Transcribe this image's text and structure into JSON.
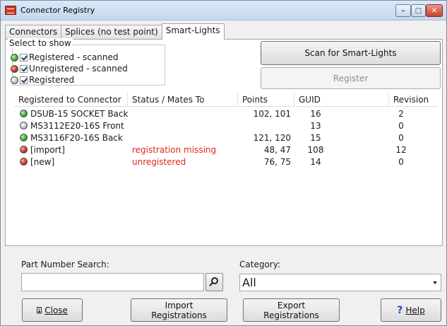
{
  "window": {
    "title": "Connector Registry",
    "controls": {
      "minimize": "–",
      "maximize": "□",
      "close": "✕"
    }
  },
  "tabs": [
    {
      "label": "Connectors",
      "active": false
    },
    {
      "label": "Splices (no test point)",
      "active": false
    },
    {
      "label": "Smart-Lights",
      "active": true
    }
  ],
  "filter": {
    "title": "Select to show",
    "options": [
      {
        "label": "Registered - scanned",
        "dot": "green",
        "checked": true
      },
      {
        "label": "Unregistered - scanned",
        "dot": "red",
        "checked": true
      },
      {
        "label": "Registered",
        "dot": "grey",
        "checked": true
      }
    ]
  },
  "actions": {
    "scan_label": "Scan for Smart-Lights",
    "register_label": "Register"
  },
  "table": {
    "columns": [
      "Registered to Connector",
      "Status / Mates To",
      "Points",
      "GUID",
      "Revision"
    ],
    "rows": [
      {
        "dot": "green",
        "name": "DSUB-15 SOCKET Back",
        "status": "",
        "points": "102, 101",
        "guid": "16",
        "revision": "2"
      },
      {
        "dot": "grey",
        "name": "MS3112E20-16S Front",
        "status": "",
        "points": "",
        "guid": "13",
        "revision": "0"
      },
      {
        "dot": "green",
        "name": "MS3116F20-16S Back",
        "status": "",
        "points": "121, 120",
        "guid": "15",
        "revision": "0"
      },
      {
        "dot": "red",
        "name": "[import]",
        "status": "registration missing",
        "points": "48, 47",
        "guid": "108",
        "revision": "12"
      },
      {
        "dot": "red",
        "name": "[new]",
        "status": "unregistered",
        "points": "76, 75",
        "guid": "14",
        "revision": "0"
      }
    ]
  },
  "search": {
    "label": "Part Number Search:",
    "value": "",
    "placeholder": ""
  },
  "category": {
    "label": "Category:",
    "selected": "All"
  },
  "footer": {
    "close_label": "Close",
    "import_label_1": "Import",
    "import_label_2": "Registrations",
    "export_label_1": "Export",
    "export_label_2": "Registrations",
    "help_label": "Help"
  },
  "colors": {
    "status_red": "#e0261b",
    "accent": "#c4d8ef"
  }
}
